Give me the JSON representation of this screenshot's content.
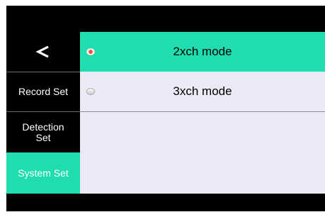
{
  "sidebar": {
    "back_icon": "chevron-left-icon",
    "items": [
      {
        "label": "Record Set"
      },
      {
        "label": "Detection\nSet"
      },
      {
        "label": "System Set"
      }
    ],
    "active_color": "#20ddb0"
  },
  "options": [
    {
      "label": "2xch mode",
      "selected": true
    },
    {
      "label": "3xch mode",
      "selected": false
    }
  ],
  "colors": {
    "accent": "#20ddb0",
    "radio_selected": "#ec5a3a",
    "content_bg": "#eceaf6",
    "screen_bg": "#000000"
  }
}
